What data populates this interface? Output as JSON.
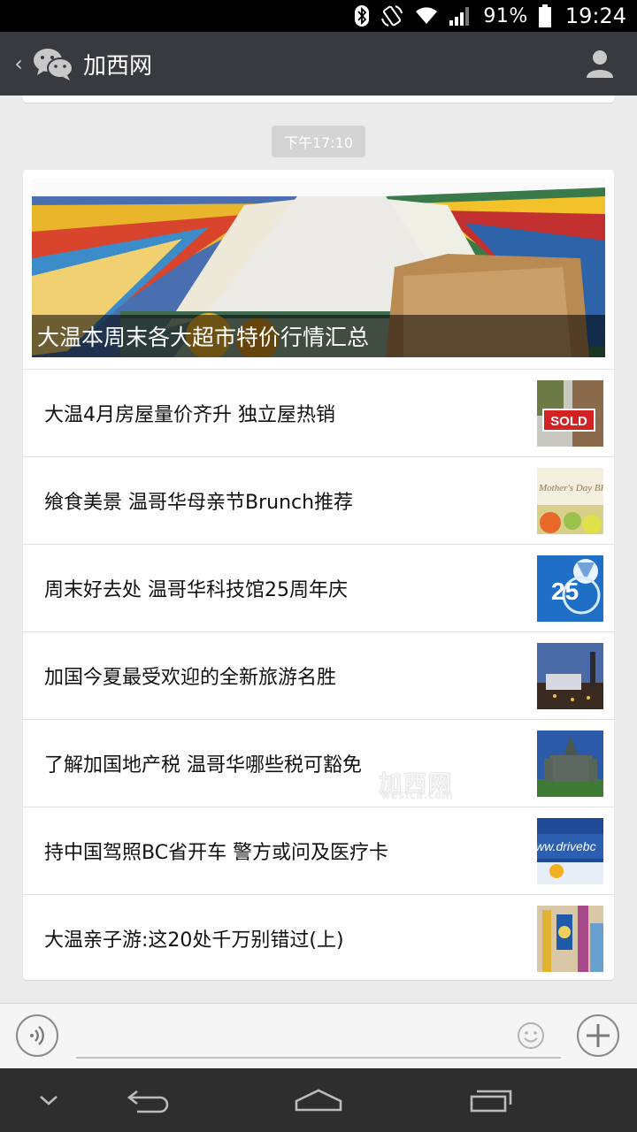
{
  "status_bar": {
    "battery": "91%",
    "time": "19:24",
    "icons": [
      "bluetooth-icon",
      "rotate-icon",
      "wifi-icon",
      "signal-icon",
      "battery-icon"
    ]
  },
  "header": {
    "back_icon": "chevron-left-icon",
    "logo_icon": "wechat-icon",
    "title": "加西网",
    "profile_icon": "person-icon"
  },
  "timestamp": "下午17:10",
  "card": {
    "hero": {
      "caption": "大温本周末各大超市特价行情汇总",
      "image": "supermarket-aisle-photo"
    },
    "articles": [
      {
        "title": "大温4月房屋量价齐升 独立屋热销",
        "thumb_label": "SOLD"
      },
      {
        "title": "飨食美景 温哥华母亲节Brunch推荐",
        "thumb_label": "Mother's Day BRUNCH"
      },
      {
        "title": "周末好去处 温哥华科技馆25周年庆",
        "thumb_label": "25"
      },
      {
        "title": "加国今夏最受欢迎的全新旅游名胜",
        "thumb_label": ""
      },
      {
        "title": "了解加国地产税 温哥华哪些税可豁免",
        "thumb_label": ""
      },
      {
        "title": "持中国驾照BC省开车 警方或问及医疗卡",
        "thumb_label": "www.drivebc"
      },
      {
        "title": "大温亲子游:这20处千万别错过(上)",
        "thumb_label": ""
      }
    ],
    "watermark": "加西网",
    "watermark_sub": "westca.com"
  },
  "input_bar": {
    "placeholder": "",
    "voice_icon": "voice-icon",
    "emoji_icon": "emoji-icon",
    "plus_icon": "plus-icon"
  },
  "nav_bar": {
    "icons": [
      "hide-keyboard-icon",
      "back-icon",
      "home-icon",
      "recents-icon"
    ]
  },
  "colors": {
    "header_bg": "#393a3f",
    "page_bg": "#ebebeb",
    "status_bg": "#000000",
    "nav_bg": "#2e2e2e"
  }
}
